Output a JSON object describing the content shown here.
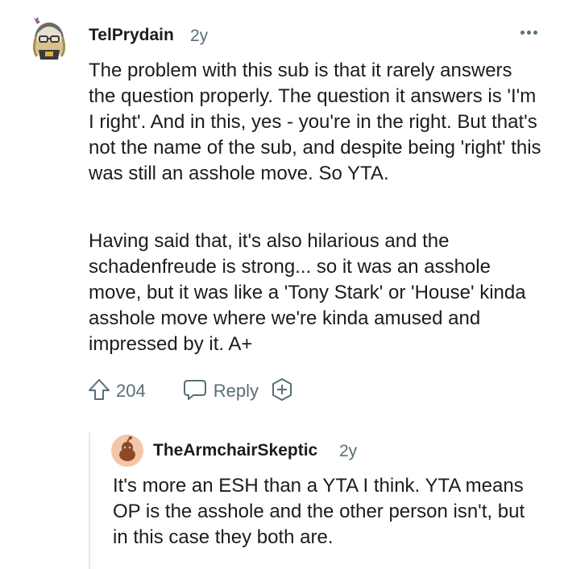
{
  "comment": {
    "author": "TelPrydain",
    "age": "2y",
    "paragraphs": [
      "The problem with this sub is that it rarely answers the question properly. The question it answers is 'I'm I right'. And in this, yes - you're in the right. But that's not the name of the sub, and despite being 'right' this was still an asshole move. So YTA.",
      "Having said that, it's also hilarious and the schadenfreude is strong... so it was an asshole move, but it was like a 'Tony Stark' or 'House' kinda asshole move where we're kinda amused and impressed by it. A+"
    ],
    "upvotes": "204",
    "reply_label": "Reply",
    "icons": {
      "avatar": "snoo-avatar-icon",
      "more": "more-options-icon",
      "upvote": "upvote-arrow-icon",
      "reply": "reply-bubble-icon",
      "award": "award-plus-icon"
    }
  },
  "reply": {
    "author": "TheArmchairSkeptic",
    "age": "2y",
    "text": "It's more an ESH than a YTA I think. YTA means OP is the asshole and the other person isn't, but in this case they both are.",
    "icons": {
      "avatar": "default-snoo-avatar-icon",
      "more": "more-options-icon"
    }
  },
  "colors": {
    "text": "#1c1c1c",
    "meta": "#576f76",
    "thread_line": "#e4e8ea",
    "reply_avatar_bg": "#f3c6a8"
  }
}
